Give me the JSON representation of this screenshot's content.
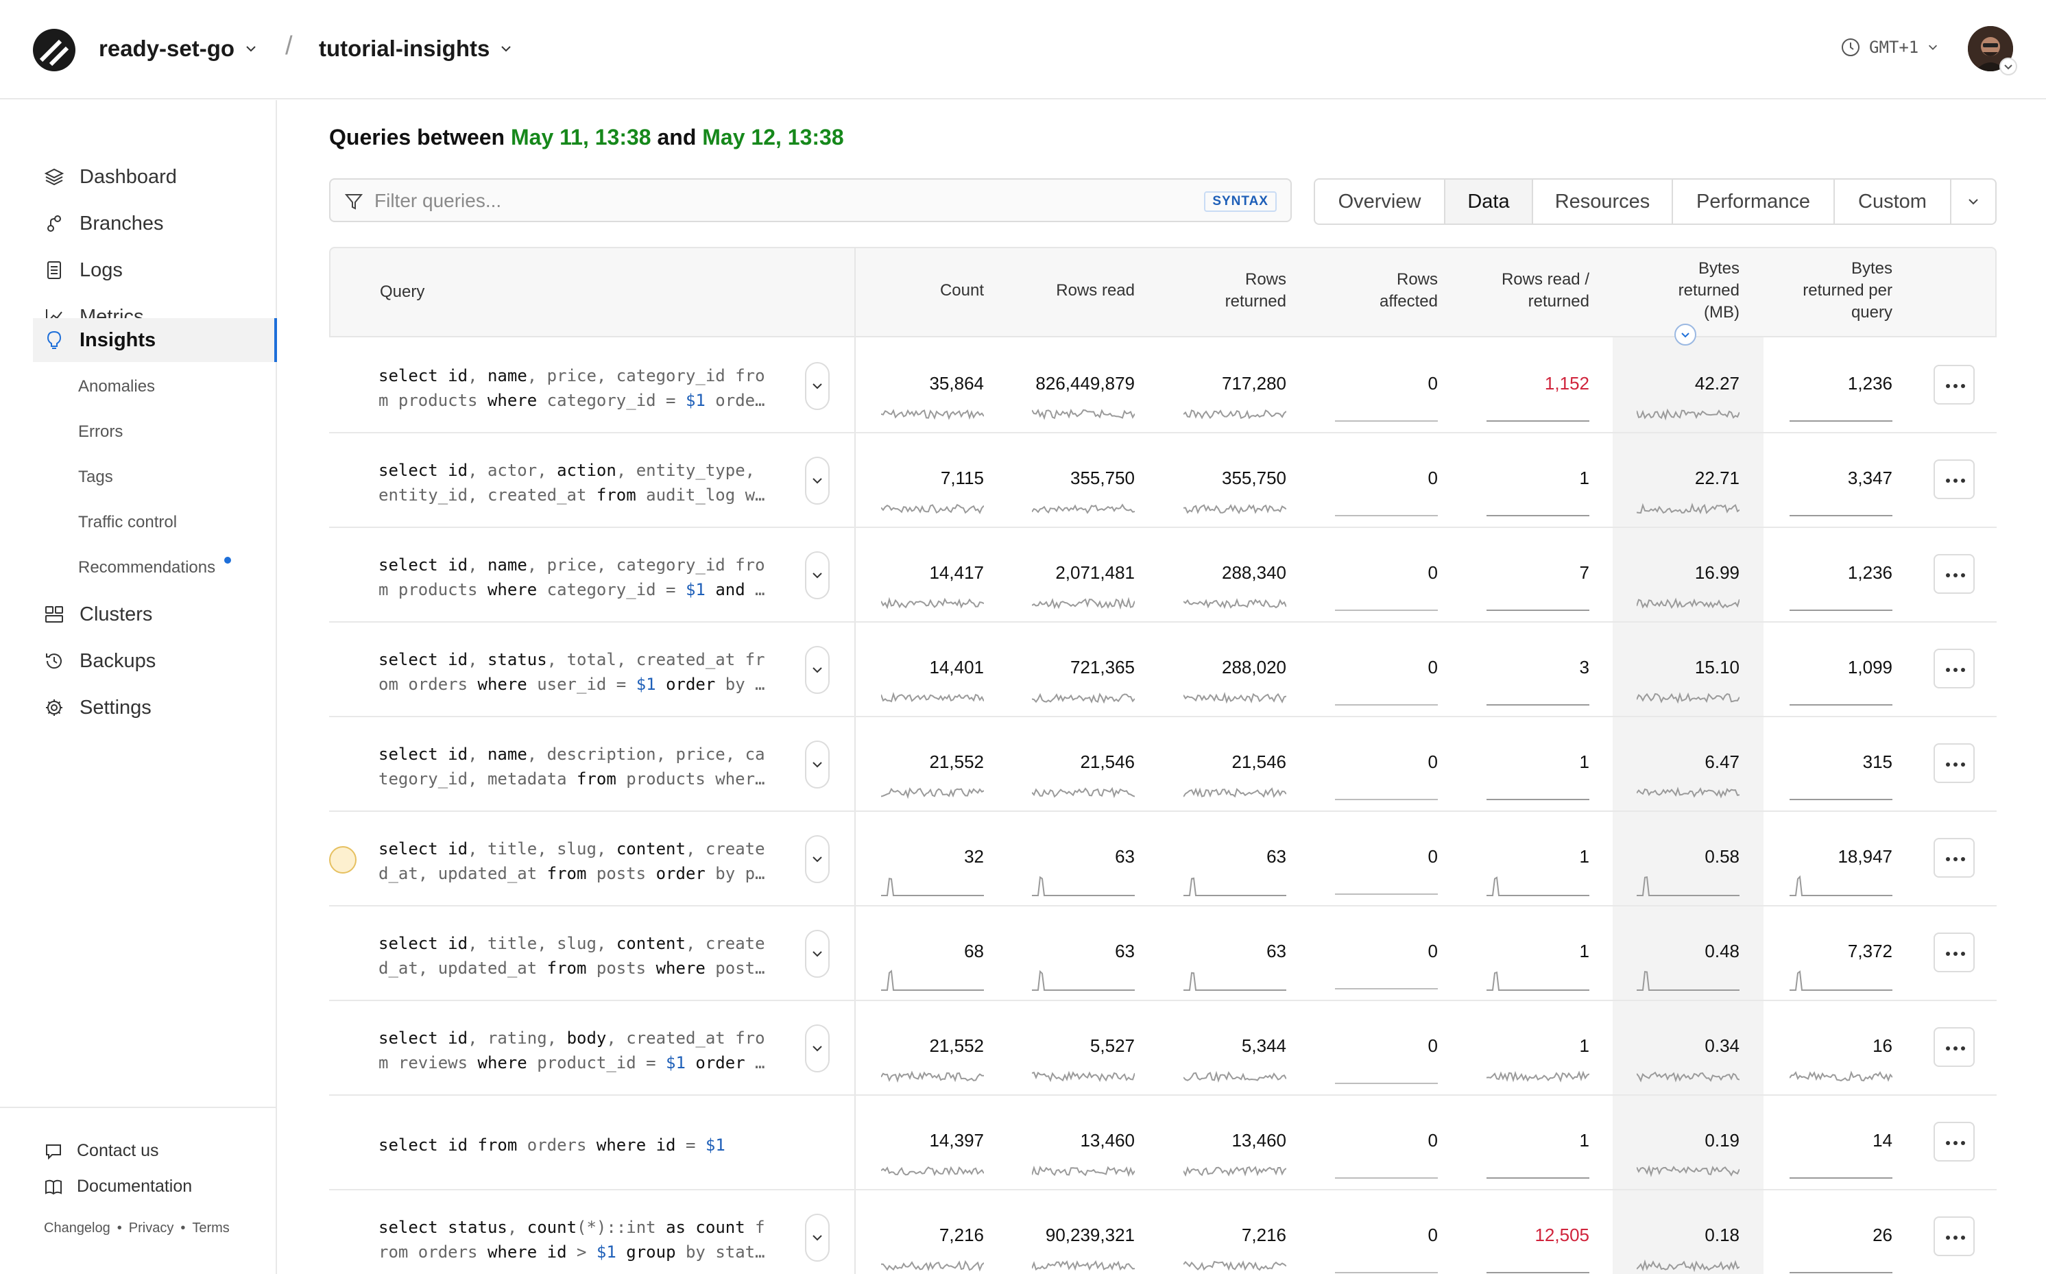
{
  "header": {
    "org": "ready-set-go",
    "database": "tutorial-insights",
    "separator": "/",
    "timezone": "GMT+1"
  },
  "sidebar": {
    "items": [
      {
        "label": "Dashboard",
        "icon": "layers-icon"
      },
      {
        "label": "Branches",
        "icon": "branch-icon"
      },
      {
        "label": "Logs",
        "icon": "document-icon"
      },
      {
        "label": "Metrics",
        "icon": "chart-icon"
      },
      {
        "label": "Insights",
        "icon": "lightbulb-icon",
        "active": true
      },
      {
        "label": "Clusters",
        "icon": "clusters-icon"
      },
      {
        "label": "Backups",
        "icon": "history-icon"
      },
      {
        "label": "Settings",
        "icon": "gear-icon"
      }
    ],
    "sub_items": [
      "Anomalies",
      "Errors",
      "Tags",
      "Traffic control",
      "Recommendations"
    ],
    "footer": {
      "contact": "Contact us",
      "docs": "Documentation",
      "links": [
        "Changelog",
        "Privacy",
        "Terms"
      ],
      "link_sep": "•"
    }
  },
  "main": {
    "title_prefix": "Queries between ",
    "from": "May 11, 13:38",
    "title_and": " and ",
    "to": "May 12, 13:38",
    "filter_placeholder": "Filter queries...",
    "syntax_label": "SYNTAX",
    "tabs": [
      "Overview",
      "Data",
      "Resources",
      "Performance",
      "Custom"
    ],
    "active_tab": "Data"
  },
  "table": {
    "columns": [
      "Query",
      "Count",
      "Rows read",
      "Rows\nreturned",
      "Rows\naffected",
      "Rows read /\nreturned",
      "Bytes\nreturned\n(MB)",
      "Bytes\nreturned per\nquery"
    ],
    "sorted_column": "Bytes returned (MB)",
    "rows": [
      {
        "query": [
          "select id, name, price, category_id fro",
          "m products where category_id = $1 orde…"
        ],
        "count": "35,864",
        "rows_read": "826,449,879",
        "rows_returned": "717,280",
        "rows_affected": "0",
        "read_returned": "1,152",
        "read_returned_flag": true,
        "bytes_mb": "42.27",
        "bytes_per_query": "1,236"
      },
      {
        "query": [
          "select id, actor, action, entity_type,",
          "entity_id, created_at from audit_log w…"
        ],
        "count": "7,115",
        "rows_read": "355,750",
        "rows_returned": "355,750",
        "rows_affected": "0",
        "read_returned": "1",
        "bytes_mb": "22.71",
        "bytes_per_query": "3,347"
      },
      {
        "query": [
          "select id, name, price, category_id fro",
          "m products where category_id = $1 and …"
        ],
        "count": "14,417",
        "rows_read": "2,071,481",
        "rows_returned": "288,340",
        "rows_affected": "0",
        "read_returned": "7",
        "bytes_mb": "16.99",
        "bytes_per_query": "1,236"
      },
      {
        "query": [
          "select id, status, total, created_at fr",
          "om orders where user_id = $1 order by …"
        ],
        "count": "14,401",
        "rows_read": "721,365",
        "rows_returned": "288,020",
        "rows_affected": "0",
        "read_returned": "3",
        "bytes_mb": "15.10",
        "bytes_per_query": "1,099"
      },
      {
        "query": [
          "select id, name, description, price, ca",
          "tegory_id, metadata from products wher…"
        ],
        "count": "21,552",
        "rows_read": "21,546",
        "rows_returned": "21,546",
        "rows_affected": "0",
        "read_returned": "1",
        "bytes_mb": "6.47",
        "bytes_per_query": "315"
      },
      {
        "query": [
          "select id, title, slug, content, create",
          "d_at, updated_at from posts order by p…"
        ],
        "warning": true,
        "count": "32",
        "rows_read": "63",
        "rows_returned": "63",
        "rows_affected": "0",
        "read_returned": "1",
        "bytes_mb": "0.58",
        "bytes_per_query": "18,947",
        "spiky": true
      },
      {
        "query": [
          "select id, title, slug, content, create",
          "d_at, updated_at from posts where post…"
        ],
        "count": "68",
        "rows_read": "63",
        "rows_returned": "63",
        "rows_affected": "0",
        "read_returned": "1",
        "bytes_mb": "0.48",
        "bytes_per_query": "7,372",
        "spiky": true
      },
      {
        "query": [
          "select id, rating, body, created_at fro",
          "m reviews where product_id = $1 order …"
        ],
        "count": "21,552",
        "rows_read": "5,527",
        "rows_returned": "5,344",
        "rows_affected": "0",
        "read_returned": "1",
        "bytes_mb": "0.34",
        "bytes_per_query": "16"
      },
      {
        "query": [
          "select id from orders where id = $1"
        ],
        "single_line": true,
        "count": "14,397",
        "rows_read": "13,460",
        "rows_returned": "13,460",
        "rows_affected": "0",
        "read_returned": "1",
        "bytes_mb": "0.19",
        "bytes_per_query": "14"
      },
      {
        "query": [
          "select status, count(*)::int as count f",
          "rom orders where id > $1 group by stat…"
        ],
        "count": "7,216",
        "rows_read": "90,239,321",
        "rows_returned": "7,216",
        "rows_affected": "0",
        "read_returned": "12,505",
        "read_returned_flag": true,
        "bytes_mb": "0.18",
        "bytes_per_query": "26"
      }
    ]
  },
  "colors": {
    "accent": "#1e6fd9",
    "date_green": "#16881b",
    "alert_red": "#d0243c",
    "warning_yellow": "#e6c060"
  }
}
